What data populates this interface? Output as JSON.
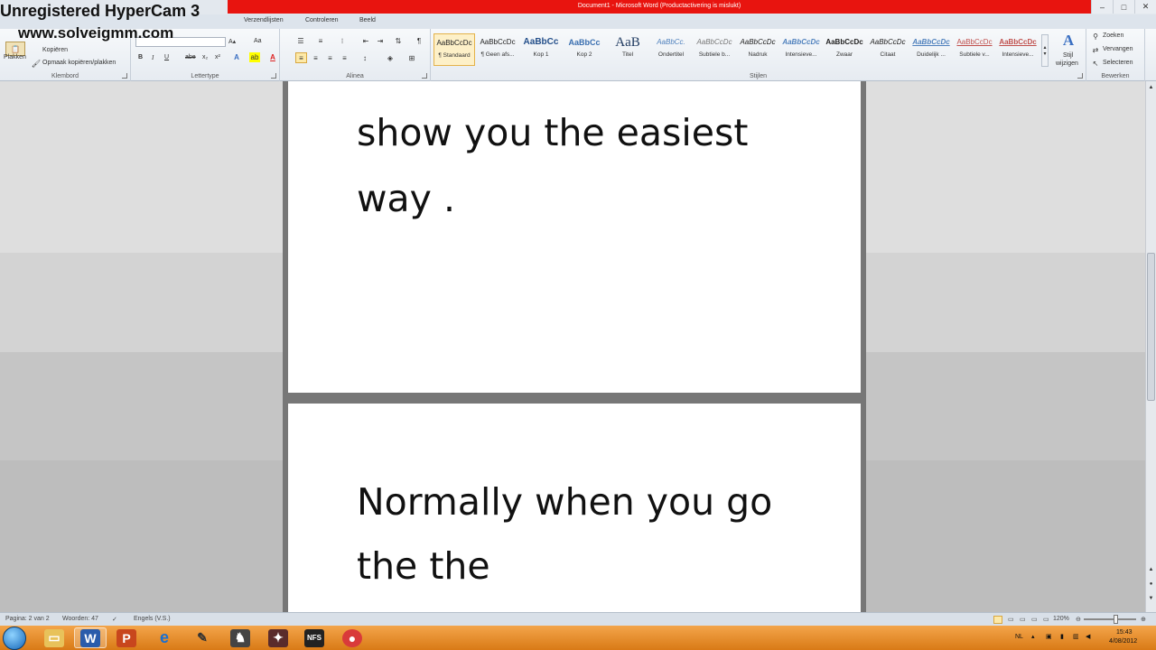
{
  "watermark": {
    "line1": "Unregistered HyperCam 3",
    "line2": "www.solveigmm.com"
  },
  "titlebar": {
    "title": "Document1 - Microsoft Word (Productactivering is mislukt)"
  },
  "tabs": [
    "Verzendlijsten",
    "Controleren",
    "Beeld"
  ],
  "ribbon": {
    "clipboard": {
      "paste": "Plakken",
      "copy": "Kopiëren",
      "format_painter": "Opmaak kopiëren/plakken",
      "label": "Klembord"
    },
    "font": {
      "label": "Lettertype",
      "bold": "B",
      "italic": "I",
      "underline": "U",
      "strike": "abe",
      "subscript": "x₂",
      "superscript": "x²",
      "grow": "A▴",
      "aa": "Aa"
    },
    "paragraph": {
      "label": "Alinea"
    },
    "styles": {
      "label": "Stijlen",
      "items": [
        {
          "sample": "AaBbCcDc",
          "name": "¶ Standaard"
        },
        {
          "sample": "AaBbCcDc",
          "name": "¶ Geen afs..."
        },
        {
          "sample": "AaBbCc",
          "name": "Kop 1"
        },
        {
          "sample": "AaBbCc",
          "name": "Kop 2"
        },
        {
          "sample": "AaB",
          "name": "Titel"
        },
        {
          "sample": "AaBbCc.",
          "name": "Ondertitel"
        },
        {
          "sample": "AaBbCcDc",
          "name": "Subtiele b..."
        },
        {
          "sample": "AaBbCcDc",
          "name": "Nadruk"
        },
        {
          "sample": "AaBbCcDc",
          "name": "Intensieve..."
        },
        {
          "sample": "AaBbCcDc",
          "name": "Zwaar"
        },
        {
          "sample": "AaBbCcDc",
          "name": "Citaat"
        },
        {
          "sample": "AaBbCcDc",
          "name": "Duidelijk ..."
        },
        {
          "sample": "AaBbCcDc",
          "name": "Subtiele v..."
        },
        {
          "sample": "AaBbCcDc",
          "name": "Intensieve..."
        }
      ],
      "change_styles_line1": "Stijl",
      "change_styles_line2": "wijzigen"
    },
    "editing": {
      "label": "Bewerken",
      "find": "Zoeken",
      "replace": "Vervangen",
      "select": "Selecteren"
    }
  },
  "document": {
    "page1_lines": [
      "show you the easiest",
      "way ."
    ],
    "page2_lines": [
      "Normally when you go",
      "the the"
    ]
  },
  "status": {
    "page": "Pagina: 2 van 2",
    "words": "Woorden: 47",
    "language": "Engels (V.S.)",
    "zoom": "120%"
  },
  "tray": {
    "lang": "NL",
    "time": "15:43",
    "date": "4/08/2012"
  },
  "colors": {
    "titlebar_red": "#e8140f",
    "taskbar_orange": "#e38c2c"
  }
}
